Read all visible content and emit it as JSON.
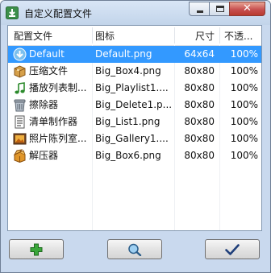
{
  "window": {
    "title": "自定义配置文件",
    "close_glyph": "✕"
  },
  "columns": {
    "name": "配置文件",
    "icon": "图标",
    "size": "尺寸",
    "transparency": "不透..."
  },
  "rows": [
    {
      "name": "Default",
      "icon": "Default.png",
      "size": "64x64",
      "transparency": "100%",
      "selected": true,
      "glyph": "download-arrow-icon"
    },
    {
      "name": "压缩文件",
      "icon": "Big_Box4.png",
      "size": "80x80",
      "transparency": "100%",
      "glyph": "box-icon"
    },
    {
      "name": "播放列表制...",
      "icon": "Big_Playlist1....",
      "size": "80x80",
      "transparency": "100%",
      "glyph": "music-note-icon"
    },
    {
      "name": "擦除器",
      "icon": "Big_Delete1.p...",
      "size": "80x80",
      "transparency": "100%",
      "glyph": "trash-icon"
    },
    {
      "name": "清单制作器",
      "icon": "Big_List1.png",
      "size": "80x80",
      "transparency": "100%",
      "glyph": "list-icon"
    },
    {
      "name": "照片陈列室...",
      "icon": "Big_Gallery1....",
      "size": "80x80",
      "transparency": "100%",
      "glyph": "photo-icon"
    },
    {
      "name": "解压器",
      "icon": "Big_Box6.png",
      "size": "80x80",
      "transparency": "100%",
      "glyph": "open-box-icon"
    }
  ],
  "colors": {
    "selection": "#3399ff",
    "window_frame": "#c9d9ee",
    "add_green": "#2e9e2e"
  }
}
